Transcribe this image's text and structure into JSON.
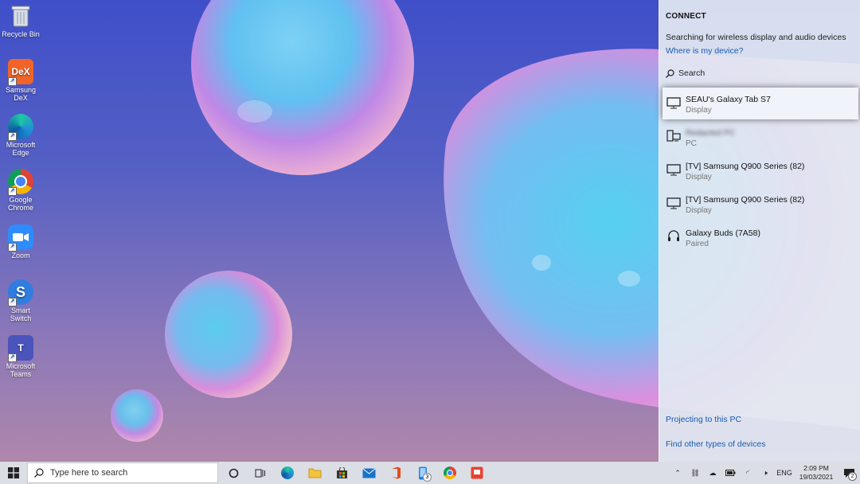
{
  "desktop": {
    "icons": [
      {
        "label": "Recycle Bin",
        "color": "#cfd6e0"
      },
      {
        "label": "Samsung DeX",
        "color": "#f0642a"
      },
      {
        "label": "Microsoft Edge",
        "color": "#1f8ad6"
      },
      {
        "label": "Google Chrome",
        "color": "#ffffff"
      },
      {
        "label": "Zoom",
        "color": "#2d8cff"
      },
      {
        "label": "Smart Switch",
        "color": "#2f7de1"
      },
      {
        "label": "Microsoft Teams",
        "color": "#4b53bc"
      }
    ],
    "dex_glyph": "DeX",
    "teams_glyph": "T"
  },
  "connect": {
    "title": "CONNECT",
    "status": "Searching for wireless display and audio devices",
    "where_link": "Where is my device?",
    "search_label": "Search",
    "devices": [
      {
        "name": "SEAU's Galaxy Tab S7",
        "type": "Display",
        "icon": "monitor-icon"
      },
      {
        "name": "Redacted PC",
        "type": "PC",
        "icon": "pc-icon"
      },
      {
        "name": "[TV] Samsung Q900 Series (82)",
        "type": "Display",
        "icon": "monitor-icon"
      },
      {
        "name": "[TV] Samsung Q900 Series (82)",
        "type": "Display",
        "icon": "monitor-icon"
      },
      {
        "name": "Galaxy Buds (7A58)",
        "type": "Paired",
        "icon": "headset-icon"
      }
    ],
    "projecting_link": "Projecting to this PC",
    "find_link": "Find other types of devices"
  },
  "taskbar": {
    "search_placeholder": "Type here to search",
    "phone_badge": "3",
    "language": "ENG",
    "time": "2:09 PM",
    "date": "19/03/2021",
    "notification_count": "2"
  },
  "colors": {
    "accent": "#1a5bb0",
    "panel_bg": "#e2e8f2",
    "taskbar_bg": "#dcdee5"
  }
}
